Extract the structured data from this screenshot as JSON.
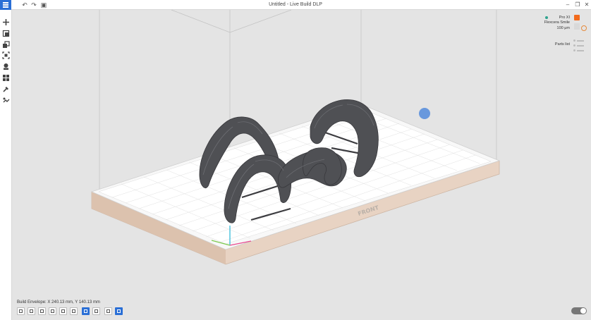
{
  "window": {
    "title": "Untitled - Live Build DLP"
  },
  "toolbar": {
    "undo_icon": "undo-icon",
    "redo_icon": "redo-icon",
    "save_icon": "save-icon"
  },
  "left_tools": [
    {
      "name": "add-icon"
    },
    {
      "name": "orient-icon"
    },
    {
      "name": "layout-icon"
    },
    {
      "name": "scale-icon"
    },
    {
      "name": "support-icon"
    },
    {
      "name": "arrange-icon"
    },
    {
      "name": "repair-icon"
    },
    {
      "name": "slice-icon"
    }
  ],
  "right_panel": {
    "printer": "Pro XI",
    "material": "Flexcera Smile",
    "layer": "100 μm",
    "parts_list": "Parts list",
    "material_color": "#f26a1b"
  },
  "viewport": {
    "front_label": "FRONT",
    "bed_color": "#ffffff",
    "base_color": "#e8d3c3"
  },
  "bottom": {
    "build_envelope": "Build Envelope:  X   240.13 mm, Y   140.13 mm"
  }
}
